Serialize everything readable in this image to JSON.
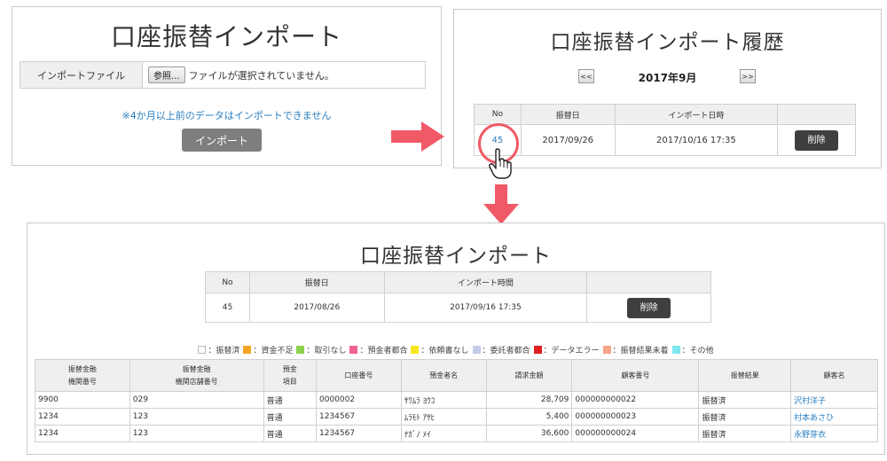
{
  "import_panel": {
    "title": "口座振替インポート",
    "file_label": "インポートファイル",
    "browse_label": "参照...",
    "file_status": "ファイルが選択されていません。",
    "note": "※4か月以上前のデータはインポートできません",
    "import_button": "インポート"
  },
  "history_panel": {
    "title": "口座振替インポート履歴",
    "prev_label": "<<",
    "next_label": ">>",
    "month": "2017年9月",
    "headers": [
      "No",
      "振替日",
      "インポート日時",
      ""
    ],
    "row": {
      "no": "45",
      "date": "2017/09/26",
      "datetime": "2017/10/16 17:35",
      "delete": "削除"
    }
  },
  "detail_panel": {
    "title": "口座振替インポート",
    "headers": [
      "No",
      "振替日",
      "インポート時間",
      ""
    ],
    "row": {
      "no": "45",
      "date": "2017/08/26",
      "datetime": "2017/09/16 17:35",
      "delete": "削除"
    },
    "legend": [
      {
        "label": "：振替済",
        "color": "#ffffff"
      },
      {
        "label": "：資金不足",
        "color": "#f5a623"
      },
      {
        "label": "：取引なし",
        "color": "#8fd14f"
      },
      {
        "label": "：預金者都合",
        "color": "#f06292"
      },
      {
        "label": "：依頼書なし",
        "color": "#f8e71c"
      },
      {
        "label": "：委託者都合",
        "color": "#c5cae9"
      },
      {
        "label": "：データエラー",
        "color": "#e02020"
      },
      {
        "label": "：振替結果未着",
        "color": "#f7a48a"
      },
      {
        "label": "：その他",
        "color": "#7ee8f0"
      }
    ],
    "result_headers": {
      "bank_code_1": "振替金融",
      "bank_code_2": "機関番号",
      "branch_code_1": "振替金融",
      "branch_code_2": "機関店舗番号",
      "deposit_type_1": "預金",
      "deposit_type_2": "項目",
      "account_no": "口座番号",
      "holder": "預金者名",
      "amount": "請求金額",
      "customer_no": "顧客番号",
      "result": "振替結果",
      "customer_name": "顧客名"
    },
    "results": [
      {
        "bank": "9900",
        "branch": "029",
        "type": "普通",
        "account": "0000002",
        "holder": "ｻﾜﾑﾗ ﾖｳｺ",
        "amount": "28,709",
        "customer_no": "000000000022",
        "result": "振替済",
        "name": "沢村洋子"
      },
      {
        "bank": "1234",
        "branch": "123",
        "type": "普通",
        "account": "1234567",
        "holder": "ﾑﾗﾓﾄ ｱｻﾋ",
        "amount": "5,400",
        "customer_no": "000000000023",
        "result": "振替済",
        "name": "村本あさひ"
      },
      {
        "bank": "1234",
        "branch": "123",
        "type": "普通",
        "account": "1234567",
        "holder": "ﾅｶﾞﾉ ﾒｲ",
        "amount": "36,600",
        "customer_no": "000000000024",
        "result": "振替済",
        "name": "永野芽衣"
      }
    ]
  },
  "colors": {
    "link": "#2a7fc0",
    "arrow": "#f05a66",
    "dark_button": "#3f3f3f"
  }
}
